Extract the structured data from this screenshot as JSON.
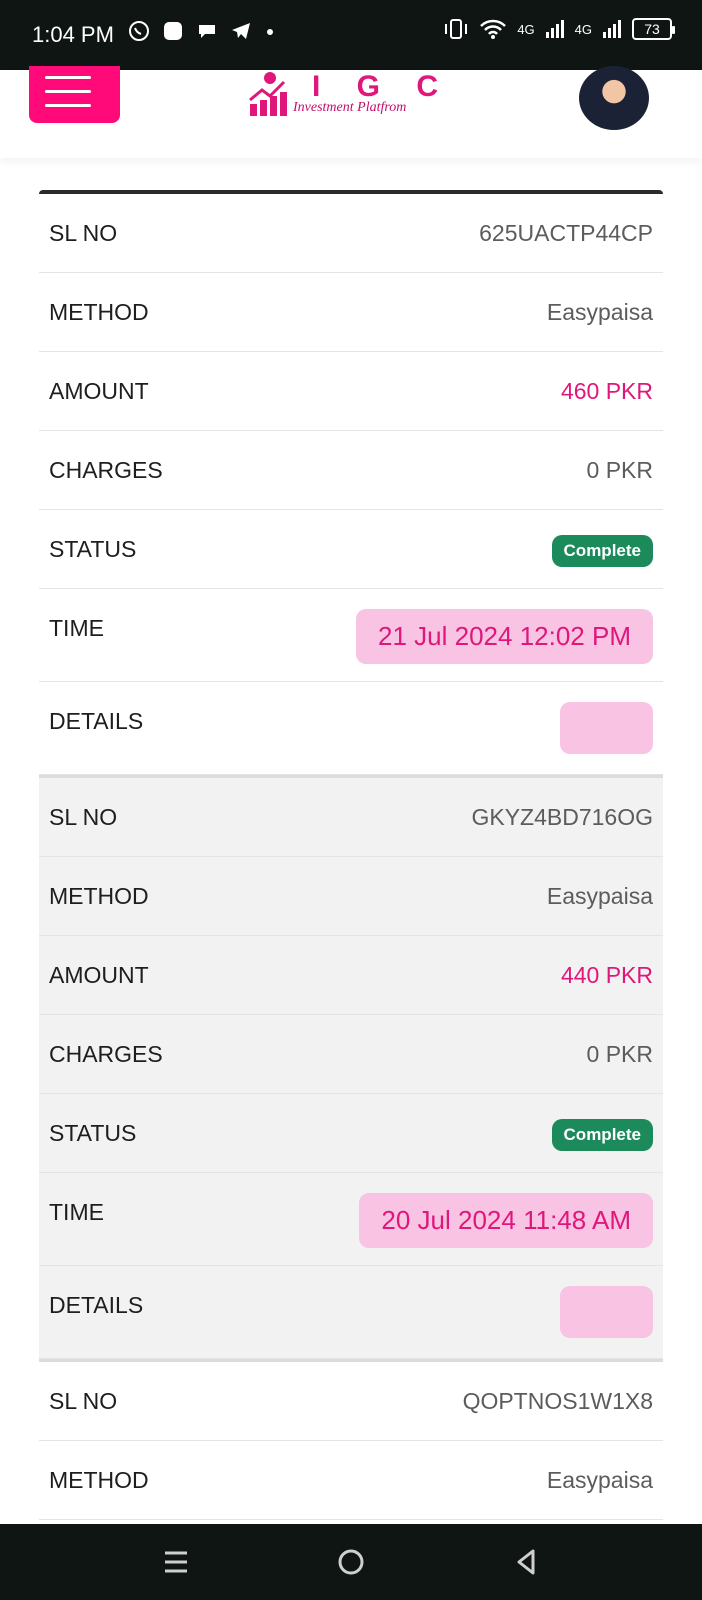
{
  "status_bar": {
    "time": "1:04 PM",
    "battery": "73",
    "network_1": "4G",
    "network_2": "4G"
  },
  "header": {
    "logo_title": "I G C",
    "logo_subtitle": "Investment Platfrom"
  },
  "records": [
    {
      "sl_no_label": "SL NO",
      "sl_no": "625UACTP44CP",
      "method_label": "METHOD",
      "method": "Easypaisa",
      "amount_label": "AMOUNT",
      "amount": "460 PKR",
      "charges_label": "CHARGES",
      "charges": "0 PKR",
      "status_label": "STATUS",
      "status": "Complete",
      "time_label": "TIME",
      "time": "21 Jul 2024 12:02 PM",
      "details_label": "DETAILS"
    },
    {
      "sl_no_label": "SL NO",
      "sl_no": "GKYZ4BD716OG",
      "method_label": "METHOD",
      "method": "Easypaisa",
      "amount_label": "AMOUNT",
      "amount": "440 PKR",
      "charges_label": "CHARGES",
      "charges": "0 PKR",
      "status_label": "STATUS",
      "status": "Complete",
      "time_label": "TIME",
      "time": "20 Jul 2024 11:48 AM",
      "details_label": "DETAILS"
    },
    {
      "sl_no_label": "SL NO",
      "sl_no": "QOPTNOS1W1X8",
      "method_label": "METHOD",
      "method": "Easypaisa"
    }
  ],
  "colors": {
    "accent": "#e0177b",
    "menu": "#ff0a78",
    "badge": "#1c8a5b",
    "pill": "#f9c3e3"
  }
}
